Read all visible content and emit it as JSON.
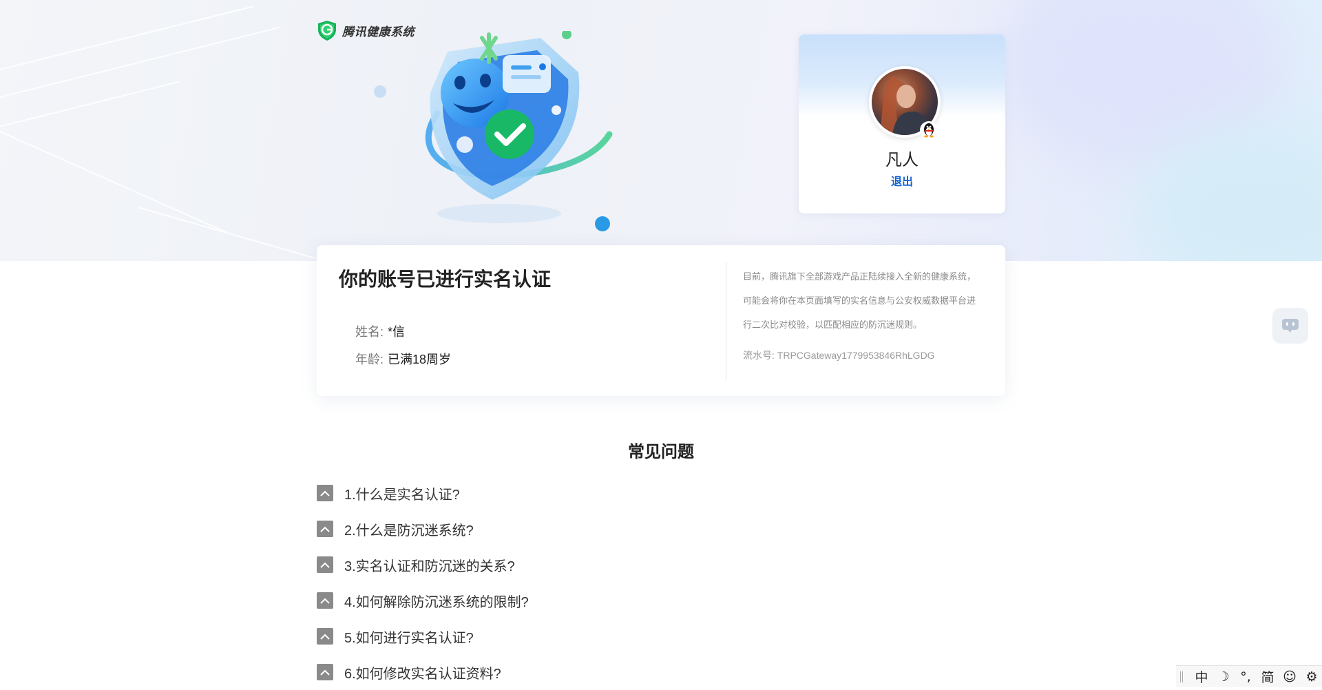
{
  "header": {
    "logo_text": "腾讯健康系统"
  },
  "profile": {
    "name": "凡人",
    "logout_label": "退出"
  },
  "verification": {
    "title": "你的账号已进行实名认证",
    "fields": [
      {
        "label": "姓名:",
        "value": "*信"
      },
      {
        "label": "年龄:",
        "value": "已满18周岁"
      }
    ],
    "notice": "目前，腾讯旗下全部游戏产品正陆续接入全新的健康系统，可能会将你在本页面填写的实名信息与公安权威数据平台进行二次比对校验，以匹配相应的防沉迷规则。",
    "serial": "流水号: TRPCGateway1779953846RhLGDG"
  },
  "faq": {
    "title": "常见问题",
    "items": [
      {
        "label": "1.什么是实名认证?"
      },
      {
        "label": "2.什么是防沉迷系统?"
      },
      {
        "label": "3.实名认证和防沉迷的关系?"
      },
      {
        "label": "4.如何解除防沉迷系统的限制?"
      },
      {
        "label": "5.如何进行实名认证?"
      },
      {
        "label": "6.如何修改实名认证资料?"
      }
    ]
  },
  "ime_toolbar": {
    "items": [
      {
        "label": "中",
        "icon": "chinese-mode-icon"
      },
      {
        "label": "☽",
        "icon": "moon-icon"
      },
      {
        "label": "°,",
        "icon": "punctuation-icon"
      },
      {
        "label": "简",
        "icon": "simplified-icon"
      },
      {
        "label": "☺",
        "icon": "emoji-icon"
      },
      {
        "label": "⚙",
        "icon": "settings-icon"
      }
    ]
  },
  "colors": {
    "accent_blue": "#1464d2",
    "brand_green": "#19b25b",
    "faq_toggle_gray": "#8a8a8a"
  }
}
